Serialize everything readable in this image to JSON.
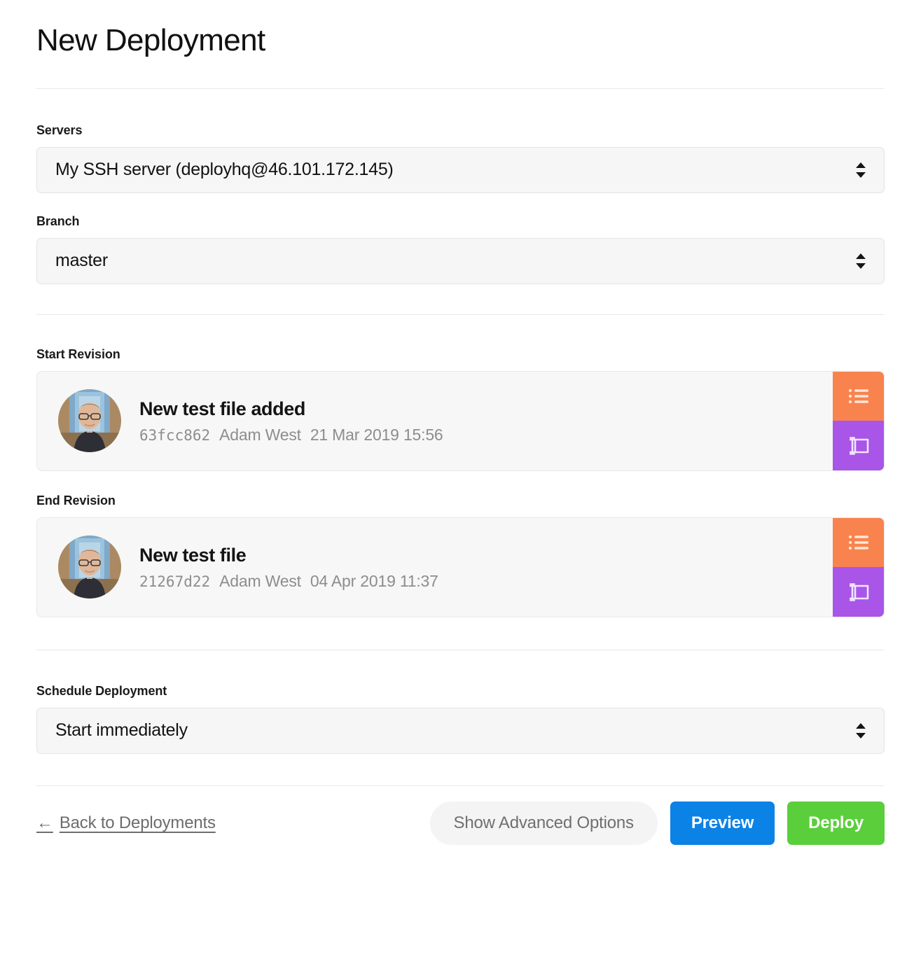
{
  "page": {
    "title": "New Deployment"
  },
  "fields": {
    "servers": {
      "label": "Servers",
      "value": "My SSH server (deployhq@46.101.172.145)"
    },
    "branch": {
      "label": "Branch",
      "value": "master"
    },
    "schedule": {
      "label": "Schedule Deployment",
      "value": "Start immediately"
    }
  },
  "revisions": {
    "start": {
      "label": "Start Revision",
      "message": "New test file added",
      "hash": "63fcc862",
      "author": "Adam West",
      "date": "21 Mar 2019 15:56",
      "actions": {
        "browse": "browse-revisions-icon",
        "manual": "manual-entry-icon"
      }
    },
    "end": {
      "label": "End Revision",
      "message": "New test file",
      "hash": "21267d22",
      "author": "Adam West",
      "date": "04 Apr 2019 11:37",
      "actions": {
        "browse": "browse-revisions-icon",
        "manual": "manual-entry-icon"
      }
    }
  },
  "footer": {
    "back_link": "Back to Deployments",
    "back_arrow": "←",
    "advanced_label": "Show Advanced Options",
    "preview_label": "Preview",
    "deploy_label": "Deploy"
  },
  "icons": {
    "select_arrows": "updown-chevron-icon",
    "avatar": "user-avatar-photo"
  },
  "colors": {
    "preview_blue": "#0b82e6",
    "deploy_green": "#5bce3c",
    "action_orange": "#f9834e",
    "action_purple": "#a855e8",
    "field_background": "#f6f6f6",
    "divider": "#e9e9e9"
  }
}
